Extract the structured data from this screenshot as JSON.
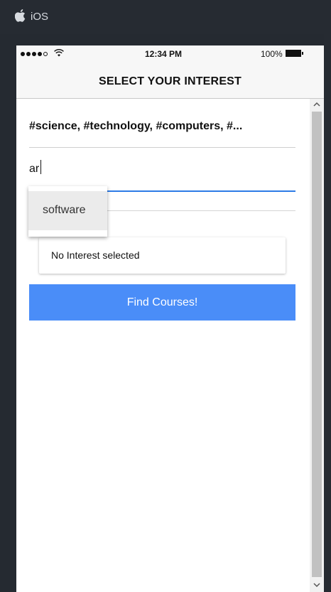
{
  "host": {
    "os_label": "iOS",
    "icon": "apple-icon"
  },
  "status_bar": {
    "time": "12:34 PM",
    "battery": "100%",
    "signal_icon": "signal-dots-icon",
    "wifi_icon": "wifi-icon",
    "battery_icon": "battery-icon"
  },
  "nav": {
    "title": "SELECT YOUR INTEREST"
  },
  "interests": {
    "tags_text": "#science, #technology, #computers, #..."
  },
  "search": {
    "value": "ar",
    "placeholder": ""
  },
  "autocomplete": {
    "items": [
      {
        "label": "software"
      }
    ]
  },
  "selection_card": {
    "text": "No Interest selected"
  },
  "cta": {
    "label": "Find Courses!"
  },
  "colors": {
    "accent": "#4a8df8",
    "input_focus": "#2d7be6",
    "background": "#252a31"
  }
}
